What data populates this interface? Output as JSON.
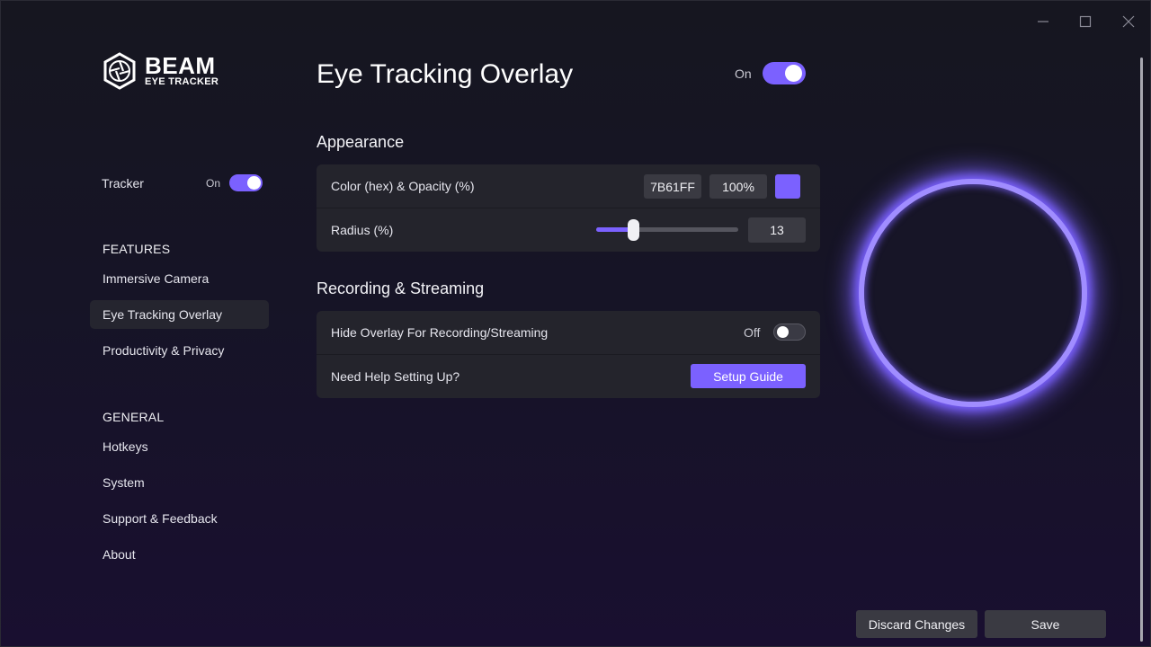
{
  "window": {
    "controls": [
      {
        "name": "minimize-icon"
      },
      {
        "name": "maximize-icon"
      },
      {
        "name": "close-icon"
      }
    ]
  },
  "logo": {
    "title": "BEAM",
    "subtitle": "EYE TRACKER",
    "icon": "aperture-icon"
  },
  "sidebar": {
    "tracker": {
      "label": "Tracker",
      "state_label": "On",
      "enabled": true
    },
    "features_heading": "FEATURES",
    "features": [
      {
        "label": "Immersive Camera",
        "active": false
      },
      {
        "label": "Eye Tracking Overlay",
        "active": true
      },
      {
        "label": "Productivity & Privacy",
        "active": false
      }
    ],
    "general_heading": "GENERAL",
    "general": [
      {
        "label": "Hotkeys"
      },
      {
        "label": "System"
      },
      {
        "label": "Support & Feedback"
      },
      {
        "label": "About"
      }
    ]
  },
  "main": {
    "title": "Eye Tracking Overlay",
    "master_toggle": {
      "state_label": "On",
      "enabled": true
    },
    "appearance": {
      "heading": "Appearance",
      "color_row": {
        "label": "Color (hex) & Opacity (%)",
        "hex": "7B61FF",
        "opacity": "100%",
        "swatch_color": "#7b61ff"
      },
      "radius_row": {
        "label": "Radius (%)",
        "value": "13",
        "slider_fraction": 0.13
      }
    },
    "recording": {
      "heading": "Recording & Streaming",
      "hide_row": {
        "label": "Hide Overlay For Recording/Streaming",
        "state_label": "Off",
        "enabled": false
      },
      "help_row": {
        "label": "Need Help Setting Up?",
        "button_label": "Setup Guide"
      }
    }
  },
  "preview": {
    "ring_color": "#7b61ff"
  },
  "footer": {
    "discard_label": "Discard Changes",
    "save_label": "Save"
  },
  "colors": {
    "accent": "#7b61ff",
    "card_bg": "#24242c",
    "field_bg": "#3a3a42"
  }
}
